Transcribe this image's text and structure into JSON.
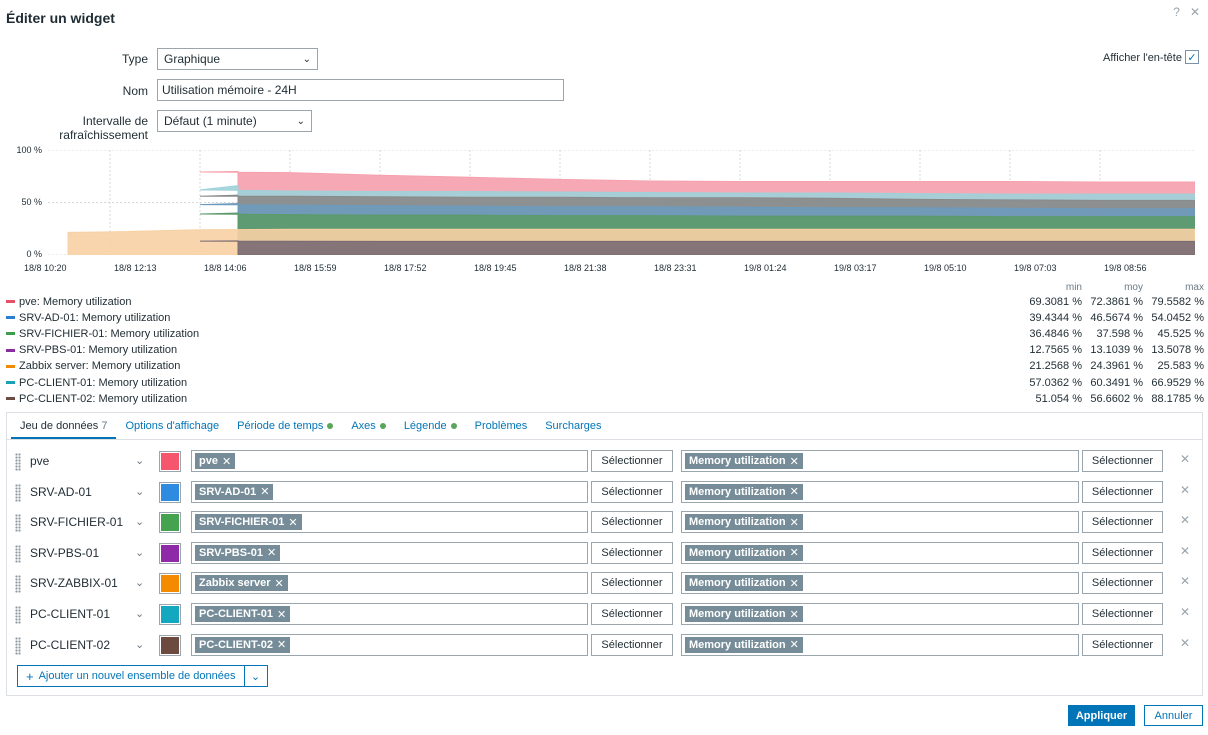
{
  "dialog": {
    "title": "Éditer un widget",
    "help_icon": "?",
    "close_icon": "✕"
  },
  "form": {
    "type_label": "Type",
    "type_value": "Graphique",
    "name_label": "Nom",
    "name_value": "Utilisation mémoire - 24H",
    "refresh_label": "Intervalle de rafraîchissement",
    "refresh_value": "Défaut (1 minute)",
    "show_header_label": "Afficher l'en-tête",
    "show_header_checked": true
  },
  "chart_data": {
    "type": "area",
    "y_ticks": [
      "100 %",
      "50 %",
      "0 %"
    ],
    "ylim": [
      0,
      100
    ],
    "x_ticks": [
      "18/8 10:20",
      "18/8 12:13",
      "18/8 14:06",
      "18/8 15:59",
      "18/8 17:52",
      "18/8 19:45",
      "18/8 21:38",
      "18/8 23:31",
      "19/8 01:24",
      "19/8 03:17",
      "19/8 05:10",
      "19/8 07:03",
      "19/8 08:56"
    ],
    "series": [
      {
        "name": "pve: Memory utilization",
        "color": "#f5a0ad",
        "values": [
          null,
          79.5,
          79,
          78.5,
          76,
          74,
          72,
          70.5,
          70,
          70,
          70,
          70,
          69.5
        ]
      },
      {
        "name": "PC-CLIENT-01: Memory utilization",
        "color": "#9fd1d9",
        "values": [
          null,
          66,
          62,
          61,
          60.5,
          60.5,
          60,
          59.5,
          59,
          59,
          58.5,
          58,
          58
        ]
      },
      {
        "name": "PC-CLIENT-02: Memory utilization",
        "color": "#8a8a8a",
        "values": [
          null,
          57,
          56,
          56,
          55.5,
          55,
          55,
          54.5,
          54.5,
          54,
          53,
          52.5,
          52
        ]
      },
      {
        "name": "SRV-AD-01: Memory utilization",
        "color": "#6d9bbd",
        "values": [
          null,
          49,
          48,
          47.5,
          47,
          46.5,
          46,
          46,
          45.5,
          45,
          45,
          44.5,
          44
        ]
      },
      {
        "name": "SRV-FICHIER-01: Memory utilization",
        "color": "#5c9a6a",
        "values": [
          null,
          40,
          39,
          38.5,
          38,
          38,
          37.5,
          37.5,
          37,
          37,
          37,
          36.5,
          36.5
        ]
      },
      {
        "name": "Zabbix server: Memory utilization",
        "color": "#f7d0a3",
        "values": [
          21.5,
          22,
          24,
          24.5,
          24.5,
          24.5,
          24.5,
          24.5,
          24.5,
          24.5,
          24.5,
          24.5,
          24.5
        ]
      },
      {
        "name": "SRV-PBS-01: Memory utilization",
        "color": "#7a6b74",
        "values": [
          null,
          13.5,
          13.2,
          13.1,
          13,
          13,
          13,
          13,
          13,
          13,
          13,
          13,
          13
        ]
      }
    ]
  },
  "legend": {
    "headers": {
      "min": "min",
      "avg": "moy",
      "max": "max"
    },
    "items": [
      {
        "name": "pve: Memory utilization",
        "color": "#e8506a",
        "min": "69.3081 %",
        "avg": "72.3861 %",
        "max": "79.5582 %"
      },
      {
        "name": "SRV-AD-01: Memory utilization",
        "color": "#2b7fd0",
        "min": "39.4344 %",
        "avg": "46.5674 %",
        "max": "54.0452 %"
      },
      {
        "name": "SRV-FICHIER-01: Memory utilization",
        "color": "#3f9e4a",
        "min": "36.4846 %",
        "avg": "37.598 %",
        "max": "45.525 %"
      },
      {
        "name": "SRV-PBS-01: Memory utilization",
        "color": "#8a2da0",
        "min": "12.7565 %",
        "avg": "13.1039 %",
        "max": "13.5078 %"
      },
      {
        "name": "Zabbix server: Memory utilization",
        "color": "#f08a00",
        "min": "21.2568 %",
        "avg": "24.3961 %",
        "max": "25.583 %"
      },
      {
        "name": "PC-CLIENT-01: Memory utilization",
        "color": "#18a2b5",
        "min": "57.0362 %",
        "avg": "60.3491 %",
        "max": "66.9529 %"
      },
      {
        "name": "PC-CLIENT-02: Memory utilization",
        "color": "#6b4d43",
        "min": "51.054 %",
        "avg": "56.6602 %",
        "max": "88.1785 %"
      }
    ]
  },
  "tabs": [
    {
      "label": "Jeu de données",
      "count": "7",
      "dot": false,
      "active": true
    },
    {
      "label": "Options d'affichage",
      "count": "",
      "dot": false,
      "active": false
    },
    {
      "label": "Période de temps",
      "count": "",
      "dot": true,
      "active": false
    },
    {
      "label": "Axes",
      "count": "",
      "dot": true,
      "active": false
    },
    {
      "label": "Légende",
      "count": "",
      "dot": true,
      "active": false
    },
    {
      "label": "Problèmes",
      "count": "",
      "dot": false,
      "active": false
    },
    {
      "label": "Surcharges",
      "count": "",
      "dot": false,
      "active": false
    }
  ],
  "datasets": [
    {
      "name": "pve",
      "color": "#f5566e",
      "host": "pve",
      "item": "Memory utilization"
    },
    {
      "name": "SRV-AD-01",
      "color": "#2f8be0",
      "host": "SRV-AD-01",
      "item": "Memory utilization"
    },
    {
      "name": "SRV-FICHIER-01",
      "color": "#45a24f",
      "host": "SRV-FICHIER-01",
      "item": "Memory utilization"
    },
    {
      "name": "SRV-PBS-01",
      "color": "#8e2aa8",
      "host": "SRV-PBS-01",
      "item": "Memory utilization"
    },
    {
      "name": "SRV-ZABBIX-01",
      "color": "#f38a00",
      "host": "Zabbix server",
      "item": "Memory utilization"
    },
    {
      "name": "PC-CLIENT-01",
      "color": "#14a8c0",
      "host": "PC-CLIENT-01",
      "item": "Memory utilization"
    },
    {
      "name": "PC-CLIENT-02",
      "color": "#6c4a3f",
      "host": "PC-CLIENT-02",
      "item": "Memory utilization"
    }
  ],
  "select_label": "Sélectionner",
  "add_dataset_label": "Ajouter un nouvel ensemble de données",
  "footer": {
    "apply_label": "Appliquer",
    "cancel_label": "Annuler"
  }
}
